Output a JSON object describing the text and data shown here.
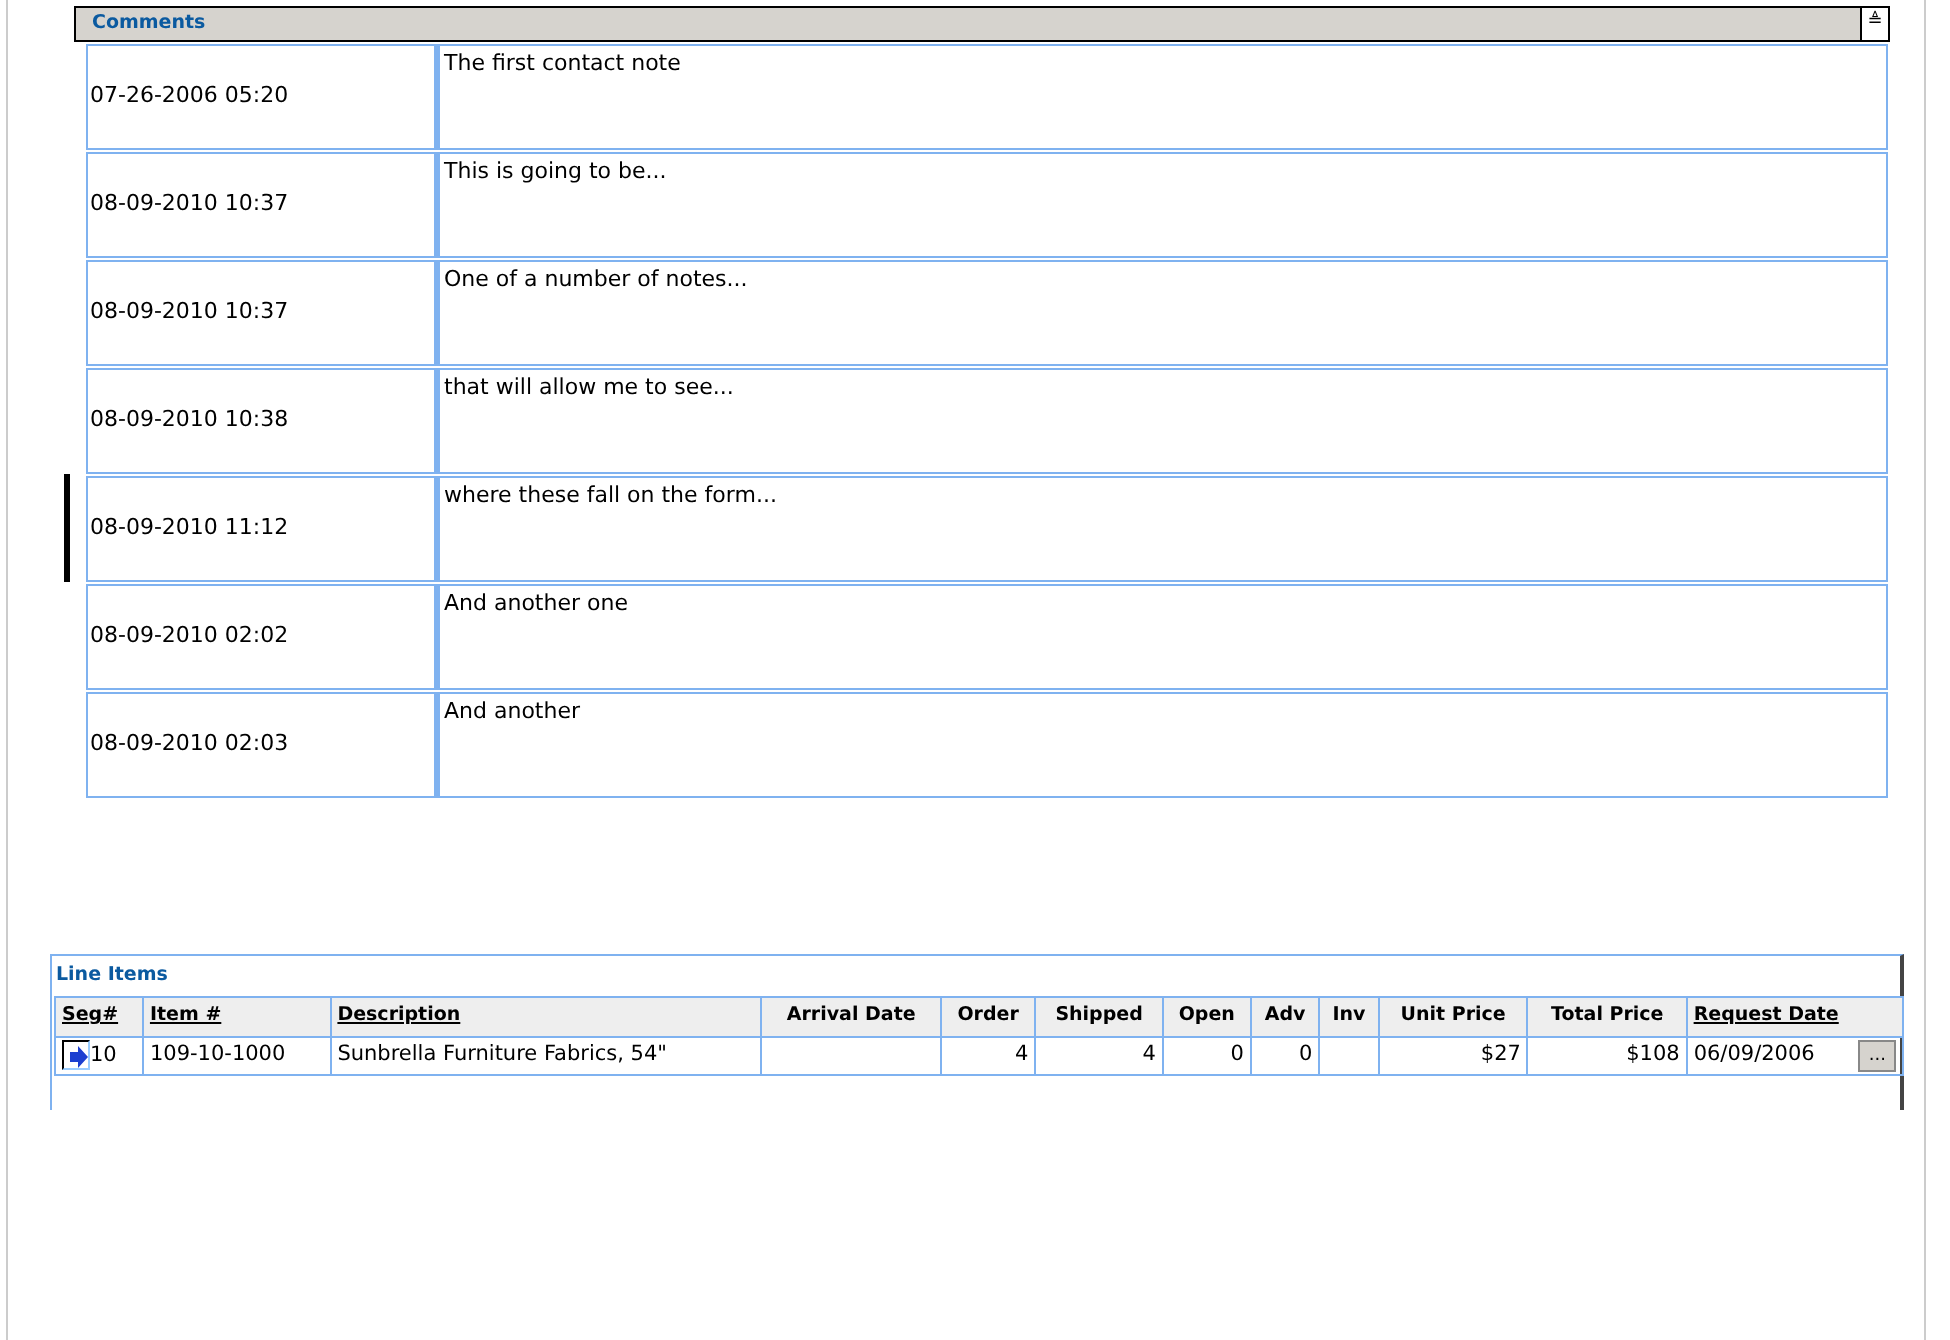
{
  "comments": {
    "title": "Comments",
    "collapse_icon": "≜",
    "rows": [
      {
        "date": "07-26-2006 05:20",
        "note": "The first contact note",
        "selected": false
      },
      {
        "date": "08-09-2010 10:37",
        "note": "This is going to be...",
        "selected": false
      },
      {
        "date": "08-09-2010 10:37",
        "note": "One of a number of notes...",
        "selected": false
      },
      {
        "date": "08-09-2010 10:38",
        "note": "that will allow me to see...",
        "selected": false
      },
      {
        "date": "08-09-2010 11:12",
        "note": "where these fall on the form...",
        "selected": true
      },
      {
        "date": "08-09-2010 02:02",
        "note": "And another one",
        "selected": false
      },
      {
        "date": "08-09-2010 02:03",
        "note": "And another",
        "selected": false
      }
    ]
  },
  "line_items": {
    "title": "Line Items",
    "columns": [
      {
        "label": "Seg#",
        "sortable": true
      },
      {
        "label": "Item #",
        "sortable": true
      },
      {
        "label": "Description",
        "sortable": true
      },
      {
        "label": "Arrival Date",
        "sortable": false
      },
      {
        "label": "Order",
        "sortable": false
      },
      {
        "label": "Shipped",
        "sortable": false
      },
      {
        "label": "Open",
        "sortable": false
      },
      {
        "label": "Adv",
        "sortable": false
      },
      {
        "label": "Inv",
        "sortable": false
      },
      {
        "label": "Unit Price",
        "sortable": false
      },
      {
        "label": "Total Price",
        "sortable": false
      },
      {
        "label": "Request Date",
        "sortable": true
      }
    ],
    "rows": [
      {
        "current": true,
        "cells": [
          "10",
          "109-10-1000",
          "Sunbrella Furniture Fabrics, 54\"",
          "",
          "4",
          "4",
          "0",
          "0",
          "",
          "$27",
          "$108",
          "06/09/2006"
        ],
        "picker": "..."
      }
    ]
  }
}
